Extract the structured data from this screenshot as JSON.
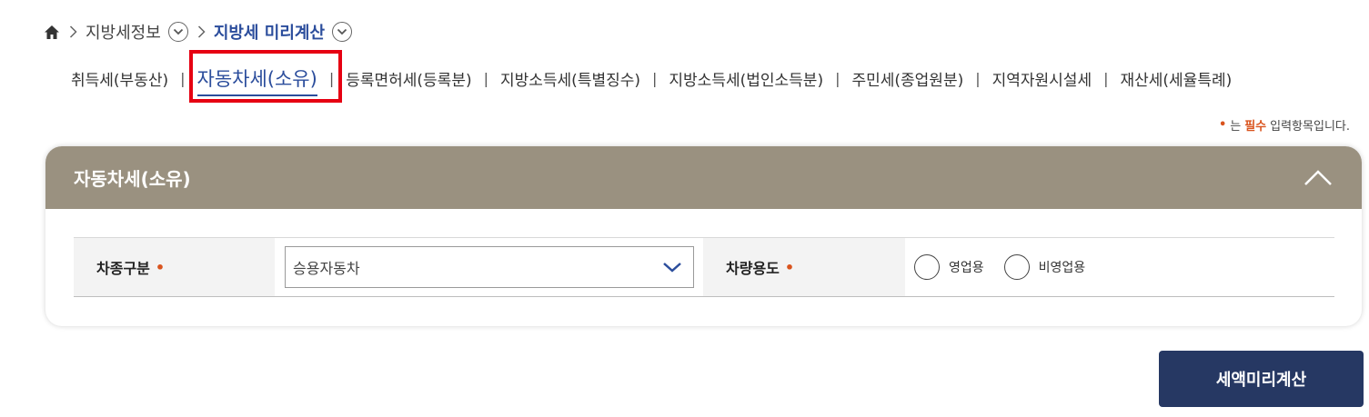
{
  "breadcrumb": {
    "home_icon": "home-icon",
    "level1": "지방세정보",
    "level2": "지방세 미리계산"
  },
  "tabs": [
    {
      "label": "취득세(부동산)",
      "active": false
    },
    {
      "label": "자동차세(소유)",
      "active": true
    },
    {
      "label": "등록면허세(등록분)",
      "active": false
    },
    {
      "label": "지방소득세(특별징수)",
      "active": false
    },
    {
      "label": "지방소득세(법인소득분)",
      "active": false
    },
    {
      "label": "주민세(종업원분)",
      "active": false
    },
    {
      "label": "지역자원시설세",
      "active": false
    },
    {
      "label": "재산세(세율특례)",
      "active": false
    }
  ],
  "required_note": {
    "bullet": "•",
    "prefix": "는",
    "word": "필수",
    "suffix": "입력항목입니다."
  },
  "panel": {
    "title": "자동차세(소유)",
    "collapse_icon": "chevron-up-icon"
  },
  "form": {
    "vehicle_type_label": "차종구분",
    "vehicle_type_value": "승용자동차",
    "vehicle_use_label": "차량용도",
    "required_mark": "•",
    "radio_options": [
      "영업용",
      "비영업용"
    ]
  },
  "calc_button_label": "세액미리계산",
  "colors": {
    "accent": "#2b4d9c",
    "header": "#9a9180",
    "button": "#263863",
    "required": "#d9541e",
    "highlight": "#e60012"
  }
}
